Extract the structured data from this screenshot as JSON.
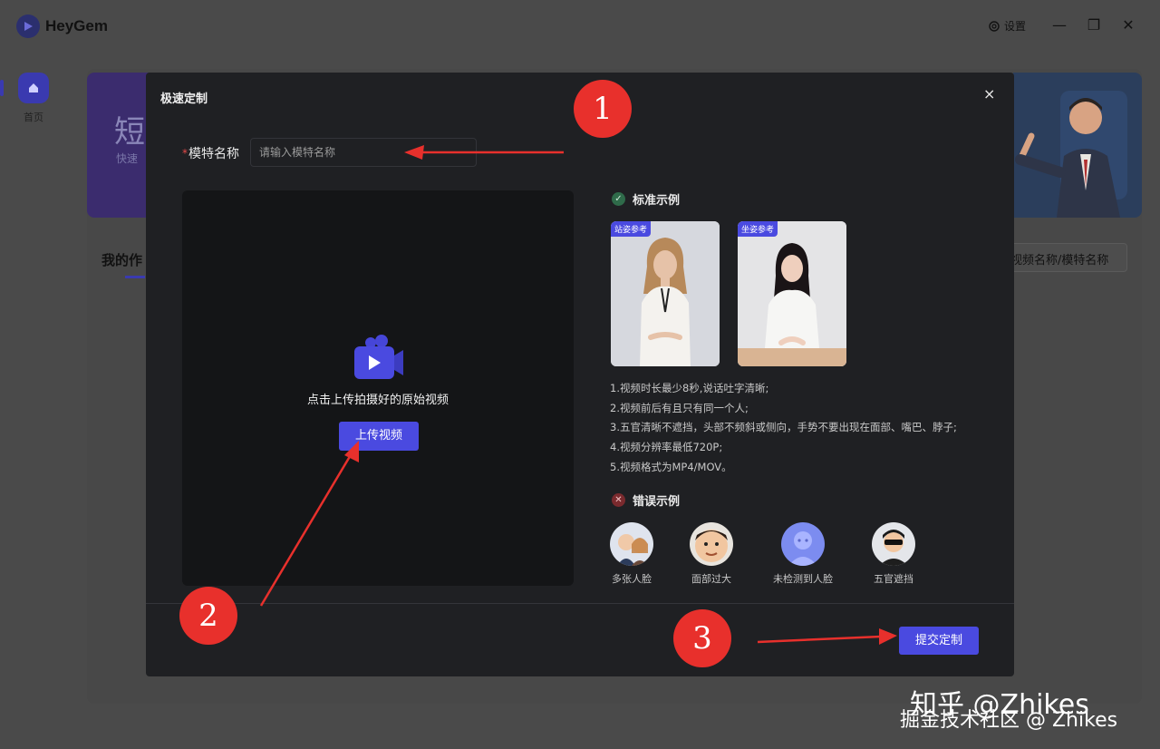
{
  "app": {
    "name": "HeyGem",
    "settings_label": "设置",
    "home_label": "首页",
    "banner_title": "短",
    "banner_sub": "快速",
    "tab_mine": "我的作",
    "search_placeholder": "视频名称/模特名称"
  },
  "modal": {
    "title": "极速定制",
    "close": "×",
    "name_label": "模特名称",
    "required_mark": "*",
    "name_placeholder": "请输入模特名称",
    "upload_hint": "点击上传拍摄好的原始视频",
    "upload_button": "上传视频",
    "standard_title": "标准示例",
    "standard_samples": [
      {
        "tag": "站姿参考"
      },
      {
        "tag": "坐姿参考"
      }
    ],
    "rules": [
      "1.视频时长最少8秒,说话吐字清晰;",
      "2.视频前后有且只有同一个人;",
      "3.五官清晰不遮挡，头部不频斜或侧向，手势不要出现在面部、嘴巴、脖子;",
      "4.视频分辨率最低720P;",
      "5.视频格式为MP4/MOV。"
    ],
    "error_title": "错误示例",
    "error_examples": [
      {
        "label": "多张人脸"
      },
      {
        "label": "面部过大"
      },
      {
        "label": "未检测到人脸"
      },
      {
        "label": "五官遮挡"
      }
    ],
    "submit_button": "提交定制"
  },
  "annotations": {
    "steps": [
      "1",
      "2",
      "3"
    ]
  },
  "watermark": {
    "line1": "知乎 @Zhikes",
    "line2": "掘金技术社区 @ Zhikes"
  },
  "colors": {
    "accent": "#4a4ae0",
    "annotation_red": "#e8302c",
    "modal_bg": "#1f2023"
  }
}
